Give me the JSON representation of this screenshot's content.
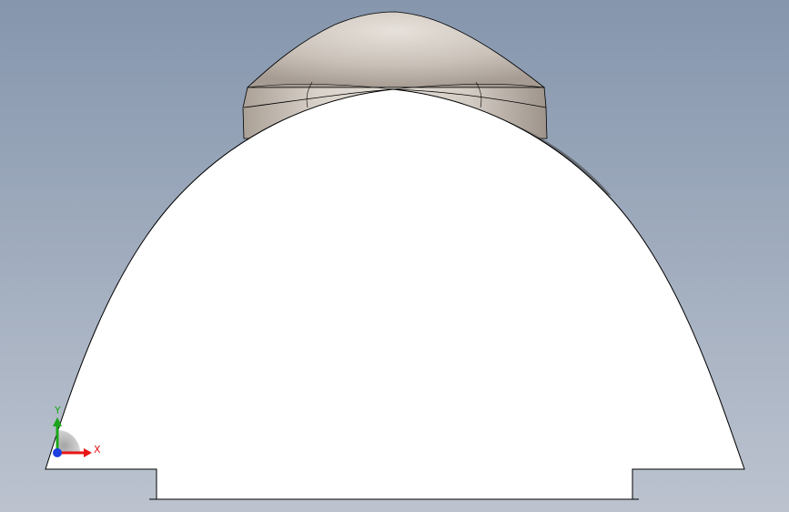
{
  "viewport": {
    "background_top": "#8596ad",
    "background_bottom": "#bcc3cf"
  },
  "model": {
    "dome_color": "#ffffff",
    "cap_color_light": "#e7e1db",
    "cap_color_dark": "#a69c93",
    "edge_color": "#000000"
  },
  "triad": {
    "x_label": "X",
    "y_label": "Y",
    "x_color": "#e81416",
    "y_color": "#1aa61a",
    "z_color": "#1d3fe0"
  }
}
